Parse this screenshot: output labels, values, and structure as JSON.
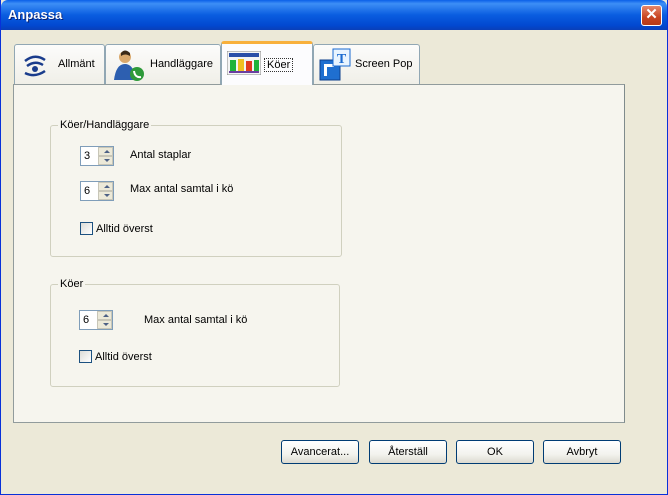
{
  "window": {
    "title": "Anpassa",
    "close_label": "✕"
  },
  "tabs": [
    {
      "label": "Allmänt",
      "icon": "general-icon"
    },
    {
      "label": "Handläggare",
      "icon": "agent-icon"
    },
    {
      "label": "Köer",
      "icon": "queues-icon",
      "active": true
    },
    {
      "label": "Screen Pop",
      "icon": "screen-pop-icon"
    }
  ],
  "group_agents": {
    "title": "Köer/Handläggare",
    "bars_value": "3",
    "bars_label": "Antal staplar",
    "max_calls_value": "6",
    "max_calls_label": "Max antal samtal i kö",
    "always_on_top_label": "Alltid överst",
    "always_on_top_checked": false
  },
  "group_queues": {
    "title": "Köer",
    "max_calls_value": "6",
    "max_calls_label": "Max antal samtal i kö",
    "always_on_top_label": "Alltid överst",
    "always_on_top_checked": false
  },
  "buttons": {
    "advanced": "Avancerat...",
    "reset": "Återställ",
    "ok": "OK",
    "cancel": "Avbryt"
  },
  "colors": {
    "titlebar": "#0a5fe8",
    "active_tab_accent": "#f8b03c",
    "face": "#ece9d8"
  }
}
